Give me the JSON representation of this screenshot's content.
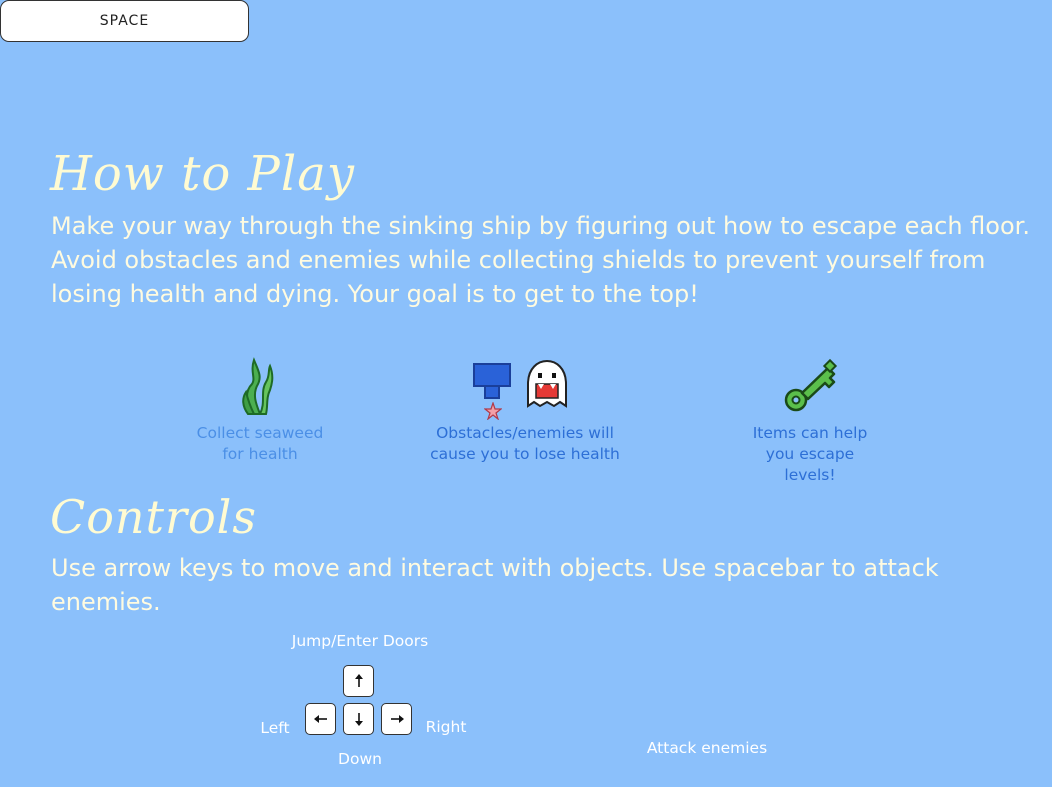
{
  "how_to_play": {
    "title": "How to Play",
    "text": "Make your way through the sinking ship by figuring out how to escape each floor. Avoid obstacles and enemies while collecting shields to prevent yourself from losing health and dying. Your goal is to get to the top!"
  },
  "items": [
    {
      "icon": "seaweed-icon",
      "caption": "Collect seaweed for health"
    },
    {
      "icon": "obstacles-enemies-icon",
      "caption": "Obstacles/enemies will cause you to lose health"
    },
    {
      "icon": "key-icon",
      "caption": "Items can help you escape levels!"
    }
  ],
  "controls": {
    "title": "Controls",
    "text": "Use arrow keys to move and interact with objects. Use spacebar to attack enemies.",
    "arrows": {
      "up_label": "Jump/Enter Doors",
      "left_label": "Left",
      "right_label": "Right",
      "down_label": "Down"
    },
    "space": {
      "key_label": "SPACE",
      "label": "Attack enemies"
    }
  },
  "colors": {
    "background": "#8bc0fb",
    "heading": "#fffbd2",
    "caption": "#2d6fd6"
  }
}
